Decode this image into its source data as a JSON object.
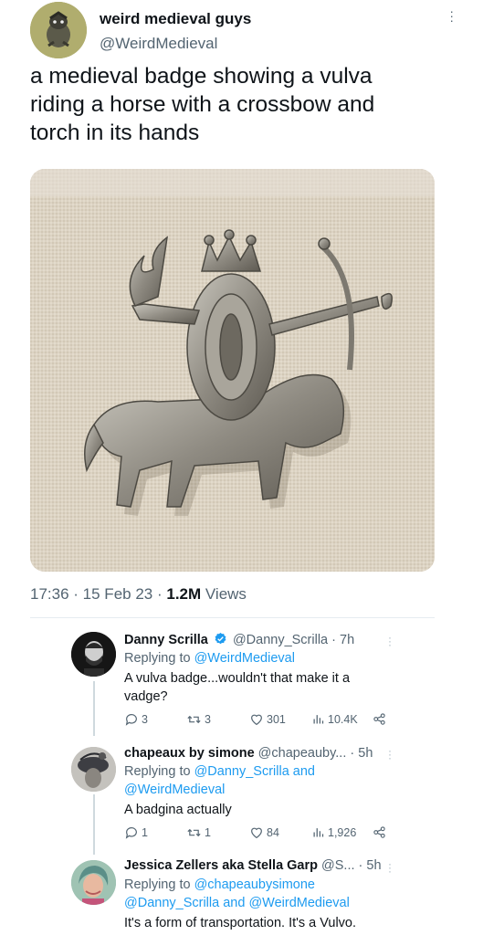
{
  "tweet": {
    "author_name": "weird medieval guys",
    "author_handle": "@WeirdMedieval",
    "text_lines": [
      "a medieval badge showing a vulva",
      "riding a horse with a crossbow and",
      "torch in its hands"
    ],
    "time": "17:36",
    "date": "15 Feb 23",
    "views_count": "1.2M",
    "views_label": "Views"
  },
  "replies": [
    {
      "name": "Danny Scrilla",
      "verified": true,
      "handle": "@Danny_Scrilla",
      "time": "7h",
      "replying_prefix": "Replying to ",
      "replying_targets": "@WeirdMedieval",
      "text_lines": [
        "A vulva badge...wouldn't that make it a",
        "vadge?"
      ],
      "replies_count": "3",
      "retweets_count": "3",
      "likes_count": "301",
      "views_count": "10.4K"
    },
    {
      "name": "chapeaux by simone",
      "handle": "@chapeauby...",
      "time": "5h",
      "replying_prefix": "Replying to ",
      "replying_line1": "@Danny_Scrilla and",
      "replying_line2": "@WeirdMedieval",
      "text_lines": [
        "A badgina actually"
      ],
      "replies_count": "1",
      "retweets_count": "1",
      "likes_count": "84",
      "views_count": "1,926"
    },
    {
      "name": "Jessica Zellers aka Stella Garp",
      "handle": "@S...",
      "time": "5h",
      "replying_prefix": "Replying to ",
      "replying_line1": "@chapeaubysimone",
      "replying_line2a": "@Danny_Scrilla",
      "replying_and": " and ",
      "replying_line2b": "@WeirdMedieval",
      "text_lines": [
        "It's a form of transportation. It's a Vulvo."
      ]
    }
  ],
  "colors": {
    "link": "#1d9bf0",
    "muted": "#536471",
    "verified": "#1d9bf0"
  }
}
